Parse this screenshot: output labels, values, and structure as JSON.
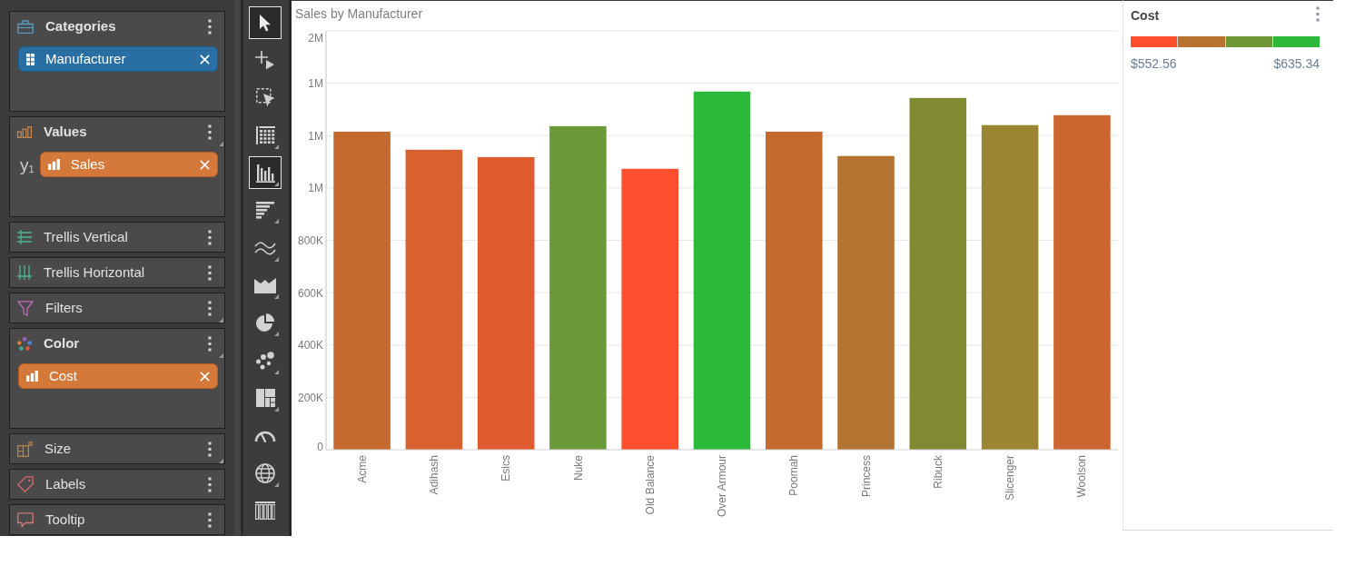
{
  "fields_panel": [
    {
      "kind": "categories",
      "label": "Categories",
      "corner_mark": false,
      "chips": [
        {
          "kind": "dimension",
          "label": "Manufacturer"
        }
      ]
    },
    {
      "kind": "values",
      "label": "Values",
      "corner_mark": true,
      "axis_label": "y$_{1}$",
      "chips": [
        {
          "kind": "measure",
          "label": "Sales"
        }
      ]
    },
    {
      "kind": "vertical",
      "label": "Trellis Vertical",
      "corner_mark": false
    },
    {
      "kind": "horizontal",
      "label": "Trellis Horizontal",
      "corner_mark": false
    },
    {
      "kind": "filters",
      "label": "Filters",
      "corner_mark": true
    },
    {
      "kind": "color",
      "label": "Color",
      "corner_mark": true,
      "chips": [
        {
          "kind": "measure",
          "label": "Cost"
        }
      ]
    },
    {
      "kind": "size",
      "label": "Size",
      "corner_mark": true
    },
    {
      "kind": "labels",
      "label": "Labels",
      "corner_mark": false
    },
    {
      "kind": "tooltip",
      "label": "Tooltip",
      "corner_mark": false
    }
  ],
  "toolbar": [
    {
      "kind": "pointer",
      "selected": true,
      "corner_mark": false
    },
    {
      "kind": "crosshair",
      "selected": false,
      "corner_mark": false
    },
    {
      "kind": "select",
      "selected": false,
      "corner_mark": false
    },
    {
      "kind": "table",
      "selected": false,
      "corner_mark": true
    },
    {
      "kind": "bar",
      "selected": true,
      "corner_mark": true
    },
    {
      "kind": "hbar",
      "selected": false,
      "corner_mark": true
    },
    {
      "kind": "line",
      "selected": false,
      "corner_mark": true
    },
    {
      "kind": "area",
      "selected": false,
      "corner_mark": true
    },
    {
      "kind": "pie",
      "selected": false,
      "corner_mark": true
    },
    {
      "kind": "scatter",
      "selected": false,
      "corner_mark": true
    },
    {
      "kind": "treemap",
      "selected": false,
      "corner_mark": true
    },
    {
      "kind": "gauge",
      "selected": false,
      "corner_mark": false
    },
    {
      "kind": "map",
      "selected": false,
      "corner_mark": true
    },
    {
      "kind": "pivot",
      "selected": false,
      "corner_mark": false
    }
  ],
  "chart": {
    "chart_data": {
      "type": "bar",
      "title": "Sales by Manufacturer",
      "categories": [
        "Acme",
        "Adihash",
        "Esics",
        "Nuke",
        "Old Balance",
        "Over Armour",
        "Poomah",
        "Princess",
        "Ribuck",
        "Slicenger",
        "Woolson"
      ],
      "values": [
        1215000,
        1146000,
        1118000,
        1236000,
        1073000,
        1368000,
        1215000,
        1122000,
        1344000,
        1240000,
        1278000
      ],
      "ylim": [
        0,
        1600000
      ],
      "yticks": [
        {
          "value": 0,
          "label": "0"
        },
        {
          "value": 200000,
          "label": "200K"
        },
        {
          "value": 400000,
          "label": "400K"
        },
        {
          "value": 600000,
          "label": "600K"
        },
        {
          "value": 800000,
          "label": "800K"
        },
        {
          "value": 1000000,
          "label": "1M"
        },
        {
          "value": 1200000,
          "label": "1M"
        },
        {
          "value": 1400000,
          "label": "1M"
        },
        {
          "value": 1600000,
          "label": "2M"
        }
      ],
      "grid": true
    },
    "bars": [
      {
        "color": "#c46a2f"
      },
      {
        "color": "#d9602f"
      },
      {
        "color": "#e05b30"
      },
      {
        "color": "#699a37"
      },
      {
        "color": "#ff4f2f"
      },
      {
        "color": "#2cb83a"
      },
      {
        "color": "#c46a2f"
      },
      {
        "color": "#b47331"
      },
      {
        "color": "#808a33"
      },
      {
        "color": "#9a8533"
      },
      {
        "color": "#cc6630"
      }
    ]
  },
  "legend": {
    "title": "Cost",
    "segments": [
      {
        "color": "#ff4f2f"
      },
      {
        "color": "#b87333"
      },
      {
        "color": "#6e9736"
      },
      {
        "color": "#2cb83a"
      }
    ],
    "min_label": "$552.56",
    "max_label": "$635.34"
  }
}
